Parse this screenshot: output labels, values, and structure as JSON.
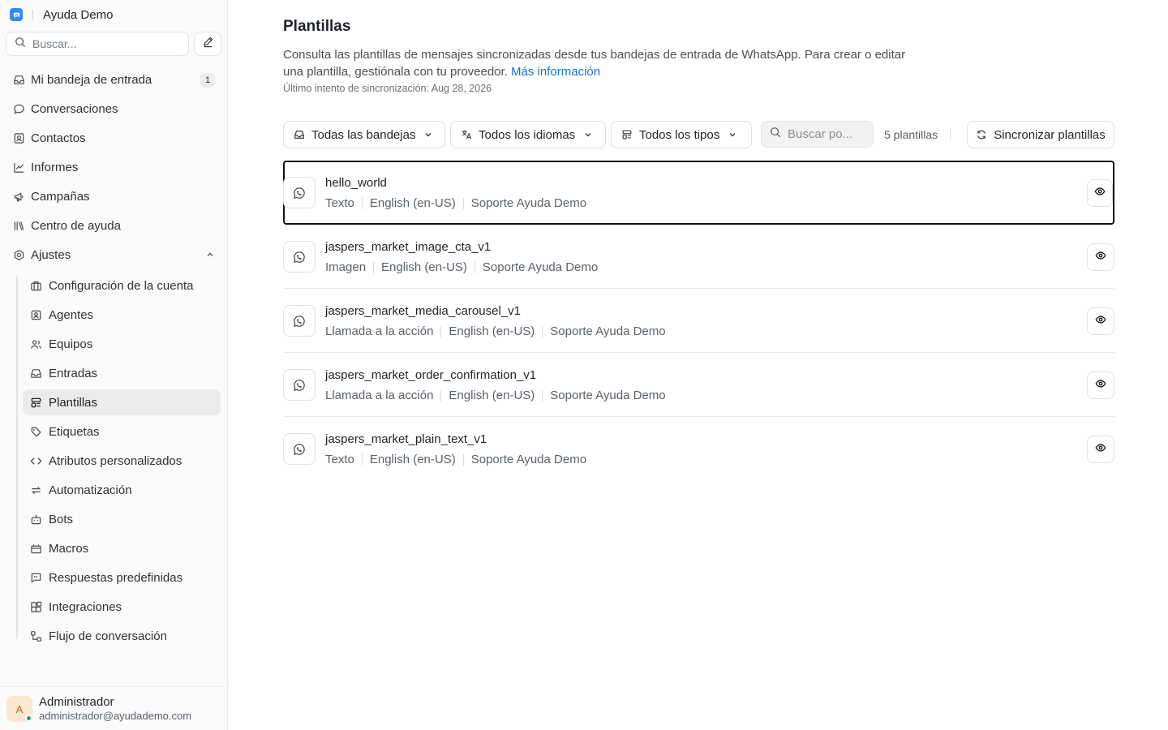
{
  "brand": {
    "name": "Ayuda Demo",
    "logo_icon": "chat-logo-icon",
    "accent": "#2f8cf0"
  },
  "search": {
    "placeholder": "Buscar..."
  },
  "nav": [
    {
      "label": "Mi bandeja de entrada",
      "icon": "inbox-icon",
      "badge": "1"
    },
    {
      "label": "Conversaciones",
      "icon": "chat-bubble-icon"
    },
    {
      "label": "Contactos",
      "icon": "contact-card-icon"
    },
    {
      "label": "Informes",
      "icon": "chart-line-icon"
    },
    {
      "label": "Campañas",
      "icon": "megaphone-icon"
    },
    {
      "label": "Centro de ayuda",
      "icon": "library-icon"
    },
    {
      "label": "Ajustes",
      "icon": "settings-icon",
      "expanded": true
    }
  ],
  "settings_nav": [
    {
      "label": "Configuración de la cuenta",
      "icon": "briefcase-icon"
    },
    {
      "label": "Agentes",
      "icon": "agent-icon"
    },
    {
      "label": "Equipos",
      "icon": "team-icon"
    },
    {
      "label": "Entradas",
      "icon": "inbox-icon"
    },
    {
      "label": "Plantillas",
      "icon": "template-icon",
      "active": true
    },
    {
      "label": "Etiquetas",
      "icon": "tag-icon"
    },
    {
      "label": "Atributos personalizados",
      "icon": "code-icon"
    },
    {
      "label": "Automatización",
      "icon": "automation-icon"
    },
    {
      "label": "Bots",
      "icon": "bot-icon"
    },
    {
      "label": "Macros",
      "icon": "macro-icon"
    },
    {
      "label": "Respuestas predefinidas",
      "icon": "quote-icon"
    },
    {
      "label": "Integraciones",
      "icon": "integrations-icon"
    },
    {
      "label": "Flujo de conversación",
      "icon": "flow-icon"
    }
  ],
  "user": {
    "initial": "A",
    "name": "Administrador",
    "email": "administrador@ayudademo.com",
    "status_color": "#22a06b"
  },
  "page": {
    "title": "Plantillas",
    "description": "Consulta las plantillas de mensajes sincronizadas desde tus bandejas de entrada de WhatsApp. Para crear o editar una plantilla, gestiónala con tu proveedor.",
    "learn_more": "Más información",
    "last_sync": "Último intento de sincronización: Aug 28, 2026"
  },
  "filters": {
    "inbox": "Todas las bandejas",
    "language": "Todos los idiomas",
    "type": "Todos los tipos",
    "search_placeholder": "Buscar po...",
    "count": "5 plantillas",
    "sync_button": "Sincronizar plantillas"
  },
  "templates": [
    {
      "name": "hello_world",
      "type": "Texto",
      "language": "English (en-US)",
      "inbox": "Soporte Ayuda Demo",
      "selected": true
    },
    {
      "name": "jaspers_market_image_cta_v1",
      "type": "Imagen",
      "language": "English (en-US)",
      "inbox": "Soporte Ayuda Demo"
    },
    {
      "name": "jaspers_market_media_carousel_v1",
      "type": "Llamada a la acción",
      "language": "English (en-US)",
      "inbox": "Soporte Ayuda Demo"
    },
    {
      "name": "jaspers_market_order_confirmation_v1",
      "type": "Llamada a la acción",
      "language": "English (en-US)",
      "inbox": "Soporte Ayuda Demo"
    },
    {
      "name": "jaspers_market_plain_text_v1",
      "type": "Texto",
      "language": "English (en-US)",
      "inbox": "Soporte Ayuda Demo"
    }
  ]
}
